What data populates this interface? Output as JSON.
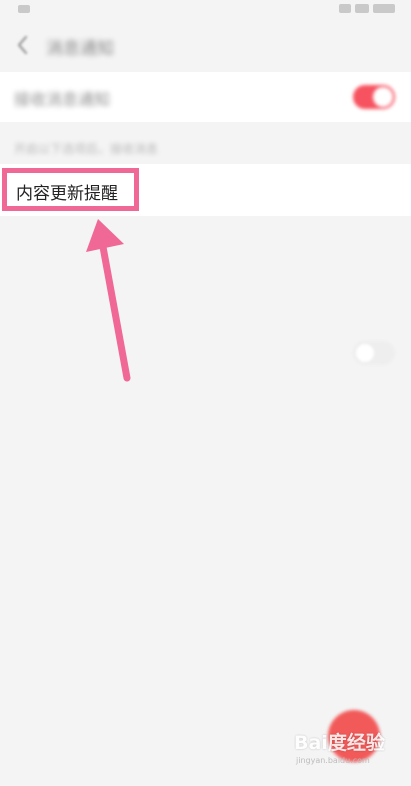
{
  "header": {
    "title": "消息通知"
  },
  "settings": {
    "master_label": "接收消息通知",
    "master_enabled": true,
    "section_hint": "开启以下选项后，接收消息",
    "content_update_label": "内容更新提醒",
    "content_update_enabled": false
  },
  "watermark": {
    "brand": "Bai度经验",
    "sub": "jingyan.baidu.com"
  },
  "colors": {
    "toggle_on": "#f6525f",
    "highlight": "#f06896",
    "fab": "#f25a5a",
    "background": "#f4f4f4"
  },
  "icons": {
    "back": "chevron-left-icon",
    "arrow": "annotation-arrow-icon"
  }
}
